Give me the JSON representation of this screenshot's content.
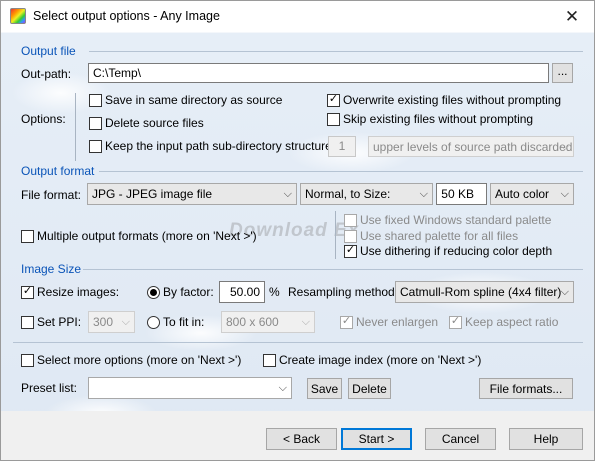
{
  "window": {
    "title": "Select output options - Any Image",
    "close_glyph": "✕",
    "app_icon": "color-palette-icon"
  },
  "output_file": {
    "group_label": "Output file",
    "out_path_label": "Out-path:",
    "out_path_value": "C:\\Temp\\",
    "browse_label": "...",
    "options_label": "Options:",
    "save_same_dir": {
      "label": "Save in same directory as source",
      "checked": false
    },
    "delete_source": {
      "label": "Delete source files",
      "checked": false
    },
    "keep_subdir": {
      "label": "Keep the input path sub-directory structure:",
      "checked": false
    },
    "levels_value": "1",
    "levels_combo": "upper levels of source path discarded",
    "overwrite": {
      "label": "Overwrite existing files without prompting",
      "checked": true
    },
    "skip_existing": {
      "label": "Skip existing files without prompting",
      "checked": false
    }
  },
  "output_format": {
    "group_label": "Output format",
    "file_format_label": "File format:",
    "file_format_value": "JPG - JPEG image file",
    "size_mode": "Normal, to Size:",
    "size_value": "50 KB",
    "color_mode": "Auto color",
    "multiple": {
      "label": "Multiple output formats (more on 'Next >')",
      "checked": false
    },
    "fixed_palette": {
      "label": "Use fixed Windows standard palette",
      "checked": false
    },
    "shared_palette": {
      "label": "Use shared palette for all files",
      "checked": false
    },
    "dithering": {
      "label": "Use dithering if reducing color depth",
      "checked": true
    }
  },
  "image_size": {
    "group_label": "Image Size",
    "resize": {
      "label": "Resize images:",
      "checked": true
    },
    "by_factor": {
      "label": "By factor:",
      "selected": true
    },
    "factor_value": "50.00",
    "percent": "%",
    "resampling_label": "Resampling method:",
    "resampling_value": "Catmull-Rom spline (4x4 filter)",
    "set_ppi": {
      "label": "Set PPI:",
      "checked": false
    },
    "ppi_value": "300",
    "to_fit_in": {
      "label": "To fit in:",
      "selected": false
    },
    "fit_value": "800 x 600",
    "never_enlarge": {
      "label": "Never enlargen",
      "checked": true
    },
    "keep_aspect": {
      "label": "Keep aspect ratio",
      "checked": true
    }
  },
  "more": {
    "select_more": {
      "label": "Select more options (more on 'Next >')",
      "checked": false
    },
    "create_index": {
      "label": "Create image index (more on 'Next >')",
      "checked": false
    },
    "preset_label": "Preset list:",
    "preset_value": "",
    "save_label": "Save",
    "delete_label": "Delete",
    "file_formats_label": "File formats..."
  },
  "buttons": {
    "back": "< Back",
    "start": "Start >",
    "cancel": "Cancel",
    "help": "Help"
  },
  "glyphs": {
    "check": "✓",
    "down": "⌵"
  }
}
